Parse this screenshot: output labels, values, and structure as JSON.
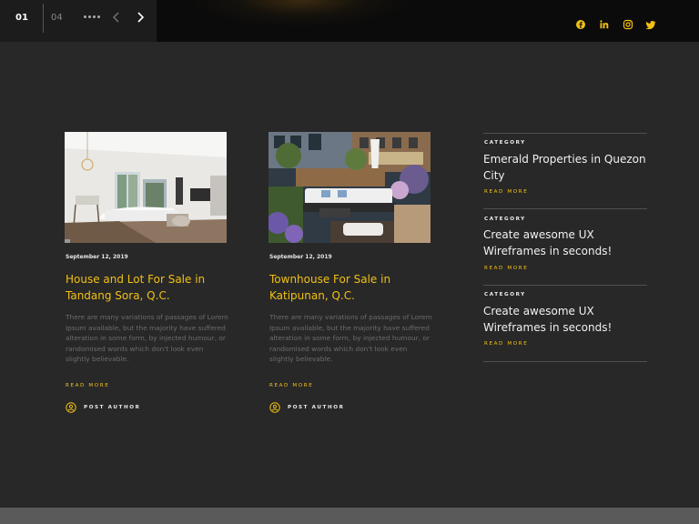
{
  "slider": {
    "current": "01",
    "total": "04"
  },
  "social": [
    {
      "icon": "facebook-icon"
    },
    {
      "icon": "linkedin-icon"
    },
    {
      "icon": "instagram-icon"
    },
    {
      "icon": "twitter-icon"
    }
  ],
  "colors": {
    "accent": "#f2c014",
    "background": "#282828"
  },
  "cards": [
    {
      "date": "September 12, 2019",
      "title": "House and Lot For Sale in Tandang Sora, Q.C.",
      "description": "There are many variations of passages of Lorem Ipsum available, but the majority have suffered alteration in some form, by injected humour, or randomised words which don't look even slightly believable.",
      "read_more": "READ MORE",
      "author": "POST AUTHOR"
    },
    {
      "date": "September 12, 2019",
      "title": "Townhouse For Sale in Katipunan, Q.C.",
      "description": "There are many variations of passages of Lorem Ipsum available, but the majority have suffered alteration in some form, by injected humour, or randomised words which don't look even slightly believable.",
      "read_more": "READ MORE",
      "author": "POST AUTHOR"
    }
  ],
  "side_posts": [
    {
      "category": "CATEGORY",
      "title": "Emerald Properties in Quezon City",
      "read_more": "READ MORE"
    },
    {
      "category": "CATEGORY",
      "title": "Create awesome UX Wireframes in seconds!",
      "read_more": "READ MORE"
    },
    {
      "category": "CATEGORY",
      "title": "Create awesome UX Wireframes in seconds!",
      "read_more": "READ MORE"
    }
  ]
}
